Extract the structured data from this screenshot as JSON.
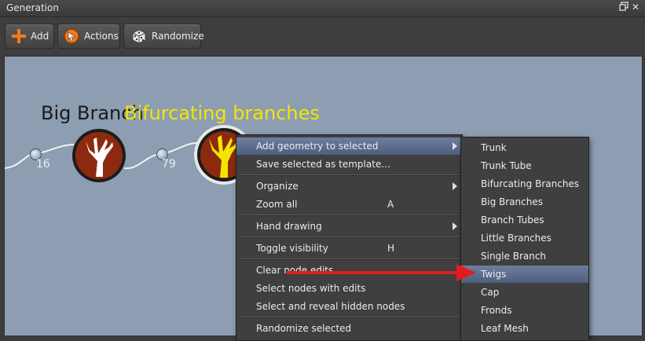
{
  "window": {
    "title": "Generation"
  },
  "toolbar": {
    "add": "Add",
    "actions": "Actions",
    "randomize": "Randomize"
  },
  "canvas": {
    "node1_title": "Big Branch",
    "node1_seed": "16",
    "node2_title": "Bifurcating branches",
    "node2_seed": "79"
  },
  "context_menu": [
    {
      "label": "Add geometry to selected",
      "shortcut": "",
      "submenu": true
    },
    {
      "label": "Save selected as template...",
      "shortcut": ""
    },
    {
      "label": "Organize",
      "shortcut": "",
      "submenu": true
    },
    {
      "label": "Zoom all",
      "shortcut": "A"
    },
    {
      "label": "Hand drawing",
      "shortcut": "",
      "submenu": true
    },
    {
      "label": "Toggle visibility",
      "shortcut": "H"
    },
    {
      "label": "Clear node edits",
      "shortcut": ""
    },
    {
      "label": "Select nodes with edits",
      "shortcut": ""
    },
    {
      "label": "Select and reveal hidden nodes",
      "shortcut": ""
    },
    {
      "label": "Randomize selected",
      "shortcut": ""
    }
  ],
  "submenu": [
    {
      "label": "Trunk"
    },
    {
      "label": "Trunk Tube"
    },
    {
      "label": "Bifurcating Branches"
    },
    {
      "label": "Big Branches"
    },
    {
      "label": "Branch Tubes"
    },
    {
      "label": "Little Branches"
    },
    {
      "label": "Single Branch"
    },
    {
      "label": "Twigs"
    },
    {
      "label": "Cap"
    },
    {
      "label": "Fronds"
    },
    {
      "label": "Leaf Mesh"
    }
  ],
  "colors": {
    "canvas_bg": "#8d9db2",
    "highlight": "#5a6b8c",
    "node_fill": "#8b2a0e",
    "selected_icon": "#f2e600",
    "arrow": "#e41b1b"
  },
  "icons": {
    "add": "plus-icon",
    "actions": "actions-icon",
    "randomize": "dice-icon"
  }
}
